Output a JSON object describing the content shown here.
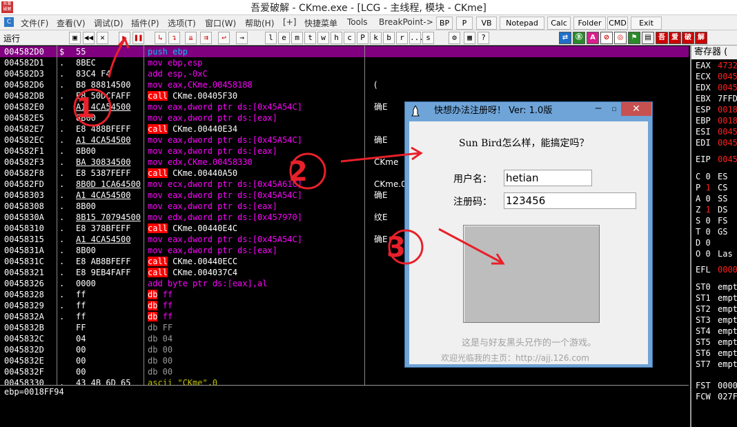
{
  "window": {
    "title": "吾爱破解 - CKme.exe - [LCG - 主线程, 模块 - CKme]"
  },
  "app_icon_text": "吾爱破解",
  "menu": {
    "items": [
      "文件(F)",
      "查看(V)",
      "调试(D)",
      "插件(P)",
      "选项(T)",
      "窗口(W)",
      "帮助(H)",
      "[+]",
      "快捷菜单",
      "Tools",
      "BreakPoint->"
    ],
    "buttons": [
      "BP",
      "P",
      "VB",
      "Notepad",
      "Calc",
      "Folder",
      "CMD",
      "Exit"
    ]
  },
  "toolbar": {
    "status": "运行",
    "letters": [
      "l",
      "e",
      "m",
      "t",
      "w",
      "h",
      "c",
      "P",
      "k",
      "b",
      "r",
      "...",
      "s"
    ],
    "right_icons": [
      "吾",
      "爱",
      "破",
      "解"
    ]
  },
  "disasm": [
    {
      "addr": "004582D0",
      "mark": "$",
      "hex": "55",
      "ops": [
        {
          "t": "push ebp",
          "c": ""
        }
      ],
      "cmt": "",
      "sel": true
    },
    {
      "addr": "004582D1",
      "mark": ".",
      "hex": "8BEC",
      "ops": [
        {
          "t": "mov ebp,esp",
          "c": ""
        }
      ],
      "cmt": ""
    },
    {
      "addr": "004582D3",
      "mark": ".",
      "hex": "83C4 F4",
      "ops": [
        {
          "t": "add esp,-0xC",
          "c": ""
        }
      ],
      "cmt": ""
    },
    {
      "addr": "004582D6",
      "mark": ".",
      "hex": "B8 88814500",
      "ops": [
        {
          "t": "mov eax,CKme.00458188",
          "c": ""
        }
      ],
      "cmt": "("
    },
    {
      "addr": "004582DB",
      "mark": ".",
      "hex": "E8 50DCFAFF",
      "ops": [
        {
          "t": "call",
          "c": "kw-call"
        },
        {
          "t": " CKme.00405F30",
          "c": "oper-call"
        }
      ],
      "cmt": ""
    },
    {
      "addr": "004582E0",
      "mark": ".",
      "hex": "A1 4CA54500",
      "ul": true,
      "ops": [
        {
          "t": "mov eax,dword ptr ds:[0x45A54C]",
          "c": ""
        }
      ],
      "cmt": "确E"
    },
    {
      "addr": "004582E5",
      "mark": ".",
      "hex": "8B00",
      "ops": [
        {
          "t": "mov eax,dword ptr ds:[eax]",
          "c": ""
        }
      ],
      "cmt": ""
    },
    {
      "addr": "004582E7",
      "mark": ".",
      "hex": "E8 488BFEFF",
      "ops": [
        {
          "t": "call",
          "c": "kw-call"
        },
        {
          "t": " CKme.00440E34",
          "c": "oper-call"
        }
      ],
      "cmt": ""
    },
    {
      "addr": "004582EC",
      "mark": ".",
      "hex": "A1 4CA54500",
      "ul": true,
      "ops": [
        {
          "t": "mov eax,dword ptr ds:[0x45A54C]",
          "c": ""
        }
      ],
      "cmt": "确E"
    },
    {
      "addr": "004582F1",
      "mark": ".",
      "hex": "8B00",
      "ops": [
        {
          "t": "mov eax,dword ptr ds:[eax]",
          "c": ""
        }
      ],
      "cmt": ""
    },
    {
      "addr": "004582F3",
      "mark": ".",
      "hex": "BA 30834500",
      "ul": true,
      "ops": [
        {
          "t": "mov edx,CKme.00458330",
          "c": ""
        }
      ],
      "cmt": "CKme"
    },
    {
      "addr": "004582F8",
      "mark": ".",
      "hex": "E8 5387FEFF",
      "ops": [
        {
          "t": "call",
          "c": "kw-call"
        },
        {
          "t": " CKme.00440A50",
          "c": "oper-call"
        }
      ],
      "cmt": ""
    },
    {
      "addr": "004582FD",
      "mark": ".",
      "hex": "8B0D 1CA64500",
      "ul": true,
      "ops": [
        {
          "t": "mov ecx,dword ptr ds:[0x45A61C]",
          "c": ""
        }
      ],
      "cmt": "CKme.0"
    },
    {
      "addr": "00458303",
      "mark": ".",
      "hex": "A1 4CA54500",
      "ul": true,
      "ops": [
        {
          "t": "mov eax,dword ptr ds:[0x45A54C]",
          "c": ""
        }
      ],
      "cmt": "确E"
    },
    {
      "addr": "00458308",
      "mark": ".",
      "hex": "8B00",
      "ops": [
        {
          "t": "mov eax,dword ptr ds:[eax]",
          "c": ""
        }
      ],
      "cmt": ""
    },
    {
      "addr": "0045830A",
      "mark": ".",
      "hex": "8B15 70794500",
      "ul": true,
      "ops": [
        {
          "t": "mov edx,dword ptr ds:[0x457970]",
          "c": ""
        }
      ],
      "cmt": "纹E"
    },
    {
      "addr": "00458310",
      "mark": ".",
      "hex": "E8 378BFEFF",
      "ops": [
        {
          "t": "call",
          "c": "kw-call"
        },
        {
          "t": " CKme.00440E4C",
          "c": "oper-call"
        }
      ],
      "cmt": ""
    },
    {
      "addr": "00458315",
      "mark": ".",
      "hex": "A1 4CA54500",
      "ul": true,
      "ops": [
        {
          "t": "mov eax,dword ptr ds:[0x45A54C]",
          "c": ""
        }
      ],
      "cmt": "确E"
    },
    {
      "addr": "0045831A",
      "mark": ".",
      "hex": "8B00",
      "ops": [
        {
          "t": "mov eax,dword ptr ds:[eax]",
          "c": ""
        }
      ],
      "cmt": ""
    },
    {
      "addr": "0045831C",
      "mark": ".",
      "hex": "E8 AB8BFEFF",
      "ops": [
        {
          "t": "call",
          "c": "kw-call"
        },
        {
          "t": " CKme.00440ECC",
          "c": "oper-call"
        }
      ],
      "cmt": ""
    },
    {
      "addr": "00458321",
      "mark": ".",
      "hex": "E8 9EB4FAFF",
      "ops": [
        {
          "t": "call",
          "c": "kw-call"
        },
        {
          "t": " CKme.004037C4",
          "c": "oper-call"
        }
      ],
      "cmt": ""
    },
    {
      "addr": "00458326",
      "mark": ".",
      "hex": "0000",
      "ops": [
        {
          "t": "add byte ptr ds:[eax],al",
          "c": ""
        }
      ],
      "cmt": ""
    },
    {
      "addr": "00458328",
      "mark": ".",
      "hex": "ff",
      "ops": [
        {
          "t": "db",
          "c": "kw-call"
        },
        {
          "t": " ff",
          "c": ""
        }
      ],
      "cmt": ""
    },
    {
      "addr": "00458329",
      "mark": ".",
      "hex": "ff",
      "ops": [
        {
          "t": "db",
          "c": "kw-call"
        },
        {
          "t": " ff",
          "c": ""
        }
      ],
      "cmt": ""
    },
    {
      "addr": "0045832A",
      "mark": ".",
      "hex": "ff",
      "ops": [
        {
          "t": "db",
          "c": "kw-call"
        },
        {
          "t": " ff",
          "c": ""
        }
      ],
      "cmt": ""
    },
    {
      "addr": "0045832B",
      "mark": "",
      "hex": "FF",
      "ops": [
        {
          "t": "db FF",
          "c": "dim"
        }
      ],
      "cmt": ""
    },
    {
      "addr": "0045832C",
      "mark": "",
      "hex": "04",
      "ops": [
        {
          "t": "db 04",
          "c": "dim"
        }
      ],
      "cmt": ""
    },
    {
      "addr": "0045832D",
      "mark": "",
      "hex": "00",
      "ops": [
        {
          "t": "db 00",
          "c": "dim"
        }
      ],
      "cmt": ""
    },
    {
      "addr": "0045832E",
      "mark": "",
      "hex": "00",
      "ops": [
        {
          "t": "db 00",
          "c": "dim"
        }
      ],
      "cmt": ""
    },
    {
      "addr": "0045832F",
      "mark": "",
      "hex": "00",
      "ops": [
        {
          "t": "db 00",
          "c": "dim"
        }
      ],
      "cmt": ""
    },
    {
      "addr": "00458330",
      "mark": ".",
      "hex": "43 4B 6D 65",
      "ops": [
        {
          "t": "ascii \"CKme\",0",
          "c": "ascii"
        }
      ],
      "cmt": ""
    }
  ],
  "command_text": "ebp=0018FF94",
  "registers": {
    "header": "寄存器 (",
    "rows": [
      {
        "n": "EAX",
        "v": "4732"
      },
      {
        "n": "ECX",
        "v": "0045"
      },
      {
        "n": "EDX",
        "v": "0045"
      },
      {
        "n": "EBX",
        "v": "7FFD",
        "white": true
      },
      {
        "n": "ESP",
        "v": "0018"
      },
      {
        "n": "EBP",
        "v": "0018"
      },
      {
        "n": "ESI",
        "v": "0045"
      },
      {
        "n": "EDI",
        "v": "0045"
      },
      {
        "n": "EIP",
        "v": "0045"
      },
      {
        "n": "C 0",
        "v": "ES",
        "white": true
      },
      {
        "n": "P 1",
        "v": "CS",
        "white": true,
        "red1": true
      },
      {
        "n": "A 0",
        "v": "SS",
        "white": true
      },
      {
        "n": "Z 1",
        "v": "DS",
        "white": true,
        "red1": true
      },
      {
        "n": "S 0",
        "v": "FS",
        "white": true
      },
      {
        "n": "T 0",
        "v": "GS",
        "white": true
      },
      {
        "n": "D 0",
        "v": "",
        "white": true
      },
      {
        "n": "O 0",
        "v": "Las",
        "white": true
      },
      {
        "n": "EFL",
        "v": "0000"
      },
      {
        "n": "ST0",
        "v": "empt",
        "white": true
      },
      {
        "n": "ST1",
        "v": "empt",
        "white": true
      },
      {
        "n": "ST2",
        "v": "empt",
        "white": true
      },
      {
        "n": "ST3",
        "v": "empt",
        "white": true
      },
      {
        "n": "ST4",
        "v": "empt",
        "white": true
      },
      {
        "n": "ST5",
        "v": "empt",
        "white": true
      },
      {
        "n": "ST6",
        "v": "empt",
        "white": true
      },
      {
        "n": "ST7",
        "v": "empt",
        "white": true
      },
      {
        "n": "FST",
        "v": "0000",
        "white": true
      },
      {
        "n": "FCW",
        "v": "027F",
        "white": true
      }
    ]
  },
  "dialog": {
    "title": "快想办法注册呀！ Ver: 1.0版",
    "question": "Sun Bird怎么样，能搞定吗？",
    "username_label": "用户名：",
    "username_value": "hetian",
    "serial_label": "注册码：",
    "serial_value": "123456",
    "footer1": "这是与好友黑头兄作的一个游戏。",
    "footer2": "欢迎光临我的主页：http://ajj.126.com",
    "close_glyph": "✕",
    "min_glyph": "—",
    "max_glyph": "☐"
  },
  "annotations": [
    "1",
    "2",
    "3"
  ],
  "colors": {
    "selection": "#800080",
    "disasm_text": "#ff00ff",
    "call_bg": "#ff0000",
    "annotation": "#e8202a",
    "dialog_frame": "#6ea4d8"
  }
}
